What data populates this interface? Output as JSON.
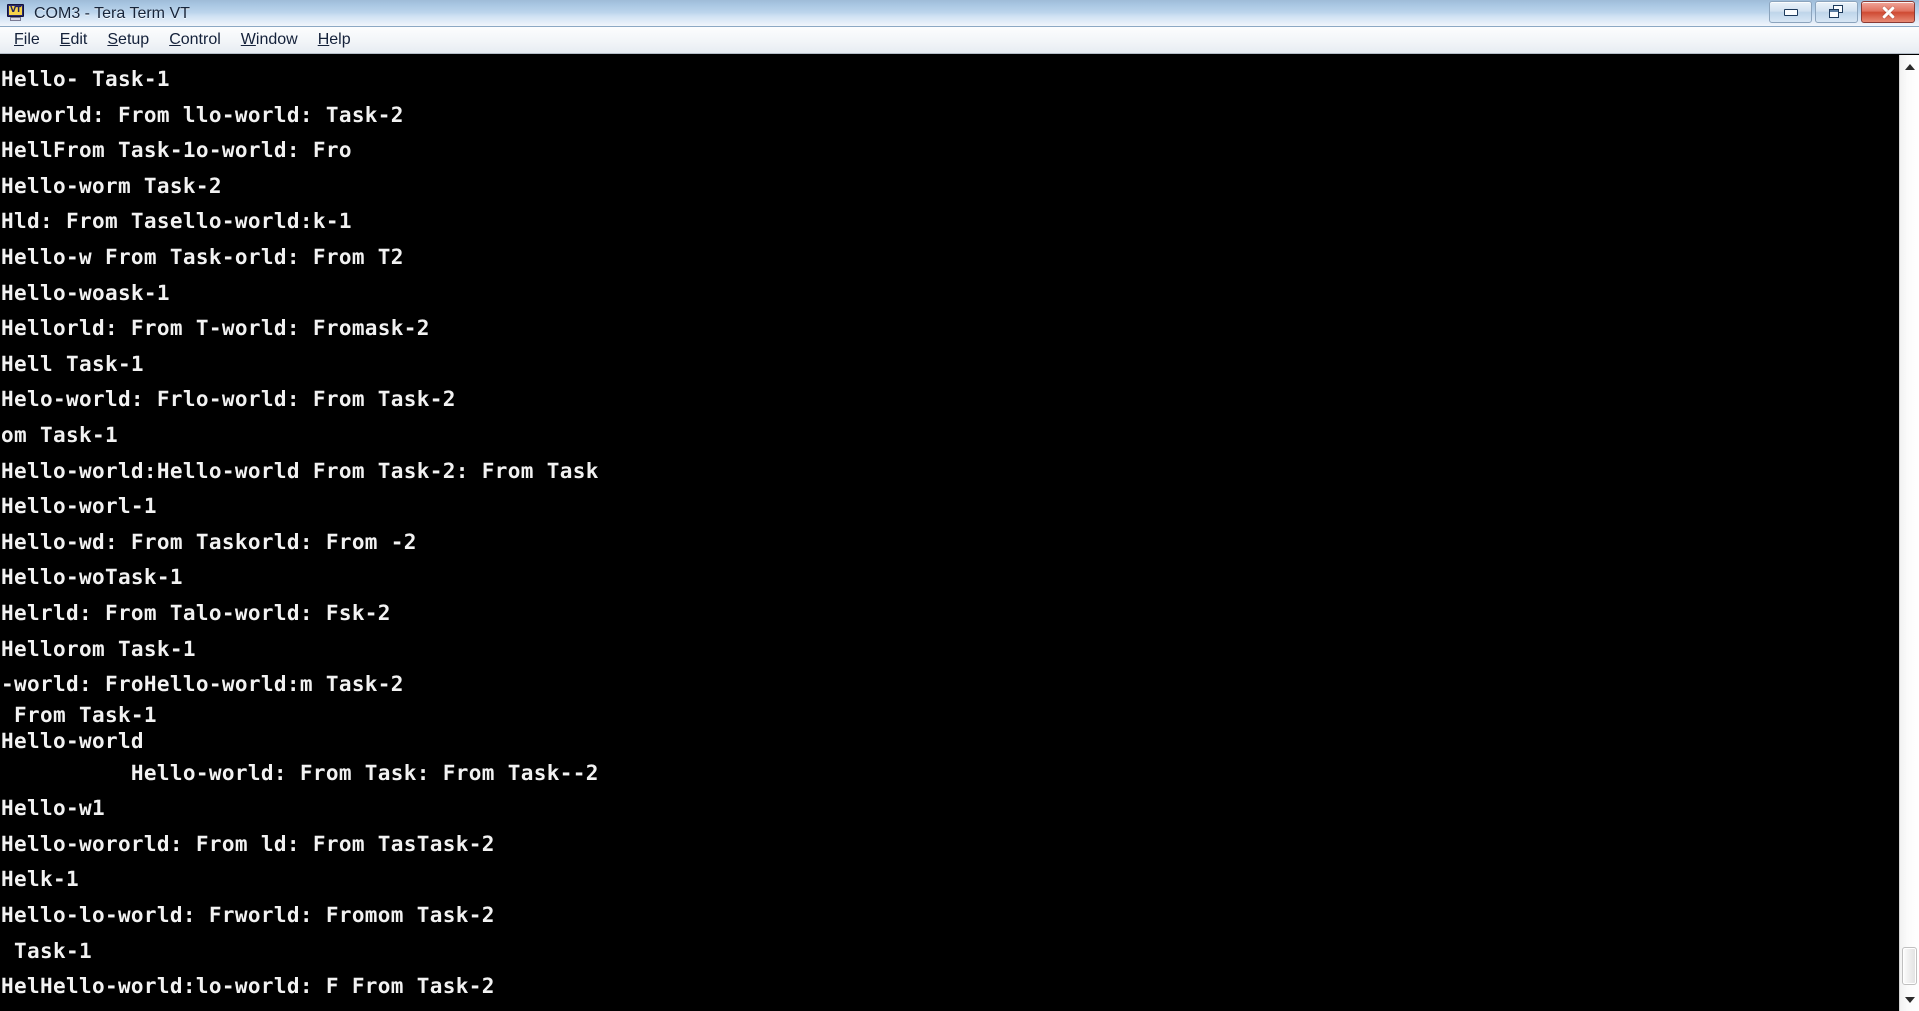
{
  "window": {
    "title": "COM3 - Tera Term VT",
    "icon": "terminal-vt-icon",
    "icon_label": "VT",
    "controls": {
      "minimize": "Minimize",
      "restore": "Restore",
      "close": "Close"
    }
  },
  "menubar": {
    "items": [
      {
        "label": "File",
        "accel": "F",
        "rest": "ile"
      },
      {
        "label": "Edit",
        "accel": "E",
        "rest": "dit"
      },
      {
        "label": "Setup",
        "accel": "S",
        "rest": "etup"
      },
      {
        "label": "Control",
        "accel": "C",
        "rest": "ontrol"
      },
      {
        "label": "Window",
        "accel": "W",
        "rest": "indow"
      },
      {
        "label": "Help",
        "accel": "H",
        "rest": "elp"
      }
    ]
  },
  "terminal": {
    "background_color": "#000000",
    "text_color": "#f2f2f2",
    "lines": [
      {
        "text": "Hello- Task-1",
        "spacing": "normal"
      },
      {
        "text": "Heworld: From llo-world: Task-2",
        "spacing": "normal"
      },
      {
        "text": "HellFrom Task-1o-world: Fro",
        "spacing": "normal"
      },
      {
        "text": "Hello-worm Task-2",
        "spacing": "normal"
      },
      {
        "text": "Hld: From Tasello-world:k-1",
        "spacing": "normal"
      },
      {
        "text": "Hello-w From Task-orld: From T2",
        "spacing": "normal"
      },
      {
        "text": "Hello-woask-1",
        "spacing": "normal"
      },
      {
        "text": "Hellorld: From T-world: Fromask-2",
        "spacing": "normal"
      },
      {
        "text": "Hell Task-1",
        "spacing": "normal"
      },
      {
        "text": "Helo-world: Frlo-world: From Task-2",
        "spacing": "normal"
      },
      {
        "text": "om Task-1",
        "spacing": "normal"
      },
      {
        "text": "Hello-world:Hello-world From Task-2: From Task",
        "spacing": "normal"
      },
      {
        "text": "Hello-worl-1",
        "spacing": "normal"
      },
      {
        "text": "Hello-wd: From Taskorld: From -2",
        "spacing": "normal"
      },
      {
        "text": "Hello-woTask-1",
        "spacing": "normal"
      },
      {
        "text": "Helrld: From Talo-world: Fsk-2",
        "spacing": "normal"
      },
      {
        "text": "Hellorom Task-1",
        "spacing": "normal"
      },
      {
        "text": "-world: FroHello-world:m Task-2",
        "spacing": "normal"
      },
      {
        "text": " From Task-1",
        "spacing": "tight"
      },
      {
        "text": "Hello-world",
        "spacing": "tight-last"
      },
      {
        "text": "          Hello-world: From Task: From Task--2",
        "spacing": "normal"
      },
      {
        "text": "Hello-w1",
        "spacing": "normal"
      },
      {
        "text": "Hello-wororld: From ld: From TasTask-2",
        "spacing": "normal"
      },
      {
        "text": "Helk-1",
        "spacing": "normal"
      },
      {
        "text": "Hello-lo-world: Frworld: Fromom Task-2",
        "spacing": "normal"
      },
      {
        "text": " Task-1",
        "spacing": "normal"
      },
      {
        "text": "HelHello-world:lo-world: F From Task-2",
        "spacing": "normal"
      }
    ]
  },
  "scrollbar": {
    "up_arrow": "scroll-up-arrow",
    "down_arrow": "scroll-down-arrow",
    "thumb": "scroll-thumb",
    "position": "near-bottom"
  }
}
